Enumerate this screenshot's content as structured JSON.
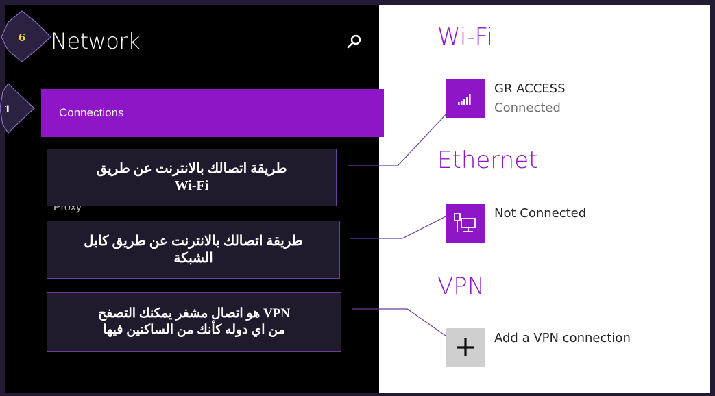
{
  "pane": {
    "title": "Network",
    "search_icon": "search-icon"
  },
  "nav": {
    "items": [
      {
        "label": "Connections",
        "selected": true
      },
      {
        "label": "Proxy",
        "selected": false
      }
    ]
  },
  "badges": {
    "title_badge": "6",
    "nav_badge": "1"
  },
  "callouts": {
    "wifi": {
      "line1": "طريقة اتصالك بالانترنت عن طريق",
      "line2": "Wi-Fi"
    },
    "ethernet": {
      "line1": "طريقة اتصالك بالانترنت عن طريق كابل",
      "line2": "الشبكة"
    },
    "vpn": {
      "line1": "VPN هو اتصال مشفر يمكنك التصفح",
      "line2": "من اي دوله كأنك من الساكنين فيها"
    }
  },
  "wifi": {
    "heading": "Wi-Fi",
    "network_name": "GR ACCESS",
    "status": "Connected",
    "icon": "wifi-signal-icon"
  },
  "ethernet": {
    "heading": "Ethernet",
    "status": "Not Connected",
    "icon": "ethernet-icon"
  },
  "vpn": {
    "heading": "VPN",
    "add_label": "Add a VPN connection",
    "icon": "plus-icon"
  },
  "colors": {
    "accent": "#8e16c7",
    "pane_background": "#000000",
    "frame": "#231a33",
    "callout_background": "#1f1a2c",
    "badge_fill": "#2b2140",
    "badge_text": "#f2d535"
  }
}
